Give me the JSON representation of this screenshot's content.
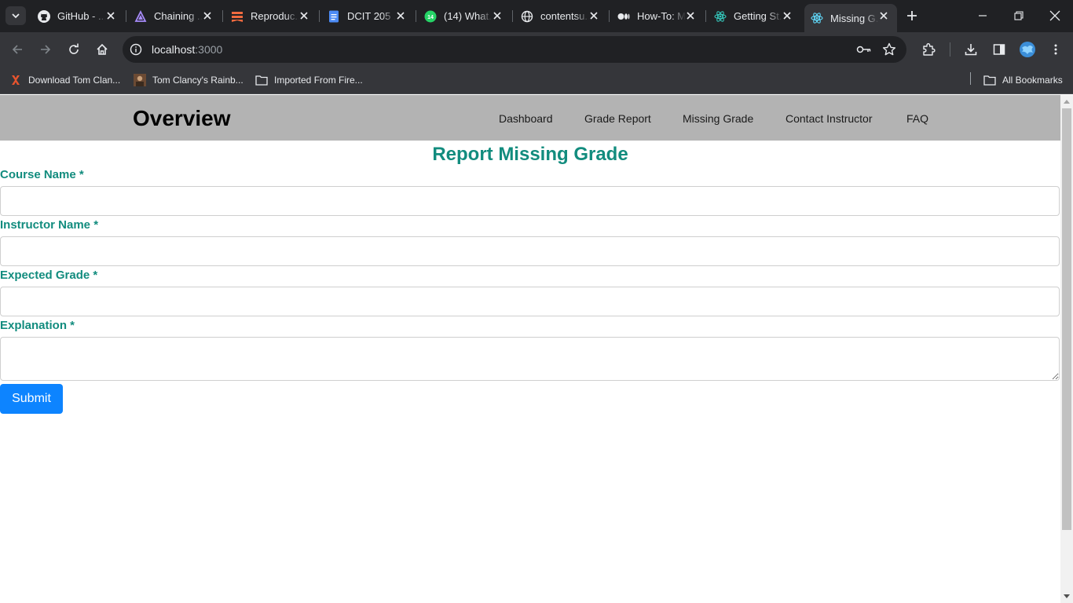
{
  "browser": {
    "tabs": [
      {
        "title": "GitHub - ...",
        "icon": "github-icon"
      },
      {
        "title": "Chaining ...",
        "icon": "purple-triangle-icon"
      },
      {
        "title": "Reproduc...",
        "icon": "stack-icon"
      },
      {
        "title": "DCIT 205 ...",
        "icon": "docs-icon"
      },
      {
        "title": "(14) What...",
        "icon": "whatsapp-icon"
      },
      {
        "title": "contentsu...",
        "icon": "globe-icon"
      },
      {
        "title": "How-To: M...",
        "icon": "medium-icon"
      },
      {
        "title": "Getting St...",
        "icon": "react-icon"
      },
      {
        "title": "Missing G...",
        "icon": "react-icon"
      }
    ],
    "whatsapp_badge": "14",
    "url_host": "localhost",
    "url_port": ":3000",
    "bookmarks": [
      {
        "label": "Download Tom Clan...",
        "icon": "x-logo-icon"
      },
      {
        "label": "Tom Clancy's Rainb...",
        "icon": "game-thumbnail-icon"
      },
      {
        "label": "Imported From Fire...",
        "icon": "folder-icon"
      }
    ],
    "all_bookmarks_label": "All Bookmarks"
  },
  "site": {
    "brand": "Overview",
    "nav": [
      "Dashboard",
      "Grade Report",
      "Missing Grade",
      "Contact Instructor",
      "FAQ"
    ]
  },
  "form": {
    "title": "Report Missing Grade",
    "course_label": "Course Name *",
    "course_value": "",
    "instructor_label": "Instructor Name *",
    "instructor_value": "",
    "grade_label": "Expected Grade *",
    "grade_value": "",
    "explanation_label": "Explanation *",
    "explanation_value": "",
    "submit_label": "Submit"
  },
  "colors": {
    "accent": "#128c7e",
    "button": "#0d84ff",
    "nav_bg": "#b3b3b3"
  }
}
